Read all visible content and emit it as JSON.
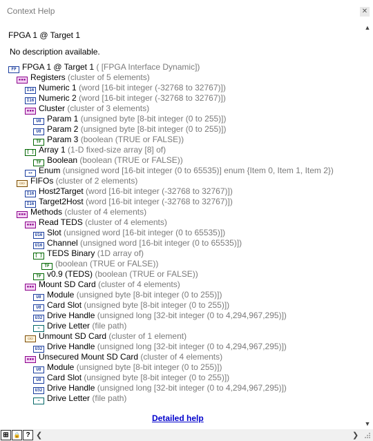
{
  "window": {
    "title": "Context Help"
  },
  "help": {
    "heading": "FPGA 1 @ Target 1",
    "description": "No description available.",
    "detailed_help_link": "Detailed help"
  },
  "icons": {
    "i16": "I16",
    "u8": "U8",
    "u16": "U16",
    "u32": "U32",
    "tf": "TF",
    "cluster": "▪▪▪",
    "array": "[ ]",
    "enum": "◂▸",
    "fifo": "▭▭",
    "fpga": "FP",
    "path": "⌁"
  },
  "tree": [
    {
      "depth": 0,
      "icon": "fpga",
      "name": "FPGA 1 @ Target 1",
      "type": "( [FPGA Interface Dynamic])"
    },
    {
      "depth": 1,
      "icon": "cluster",
      "name": "Registers",
      "type": "(cluster of 5 elements)"
    },
    {
      "depth": 2,
      "icon": "i16",
      "name": "Numeric 1",
      "type": "(word [16-bit integer (-32768 to 32767)])"
    },
    {
      "depth": 2,
      "icon": "i16",
      "name": "Numeric 2",
      "type": "(word [16-bit integer (-32768 to 32767)])"
    },
    {
      "depth": 2,
      "icon": "cluster",
      "name": "Cluster",
      "type": "(cluster of 3 elements)"
    },
    {
      "depth": 3,
      "icon": "u8",
      "name": "Param 1",
      "type": "(unsigned byte [8-bit integer (0 to 255)])"
    },
    {
      "depth": 3,
      "icon": "u8",
      "name": "Param 2",
      "type": "(unsigned byte [8-bit integer (0 to 255)])"
    },
    {
      "depth": 3,
      "icon": "tf",
      "name": "Param 3",
      "type": "(boolean (TRUE or FALSE))"
    },
    {
      "depth": 2,
      "icon": "array",
      "name": "Array 1",
      "type": "(1-D fixed-size array [8] of)"
    },
    {
      "depth": 3,
      "icon": "tf",
      "name": "Boolean",
      "type": "(boolean (TRUE or FALSE))"
    },
    {
      "depth": 2,
      "icon": "enum",
      "name": "Enum",
      "type": "(unsigned word [16-bit integer (0 to 65535)] enum {Item 0, Item 1, Item 2})"
    },
    {
      "depth": 1,
      "icon": "fifo",
      "name": "FIFOs",
      "type": "(cluster of 2 elements)"
    },
    {
      "depth": 2,
      "icon": "i16",
      "name": "Host2Target",
      "type": "(word [16-bit integer (-32768 to 32767)])"
    },
    {
      "depth": 2,
      "icon": "i16",
      "name": "Target2Host",
      "type": "(word [16-bit integer (-32768 to 32767)])"
    },
    {
      "depth": 1,
      "icon": "cluster",
      "name": "Methods",
      "type": "(cluster of 4 elements)"
    },
    {
      "depth": 2,
      "icon": "cluster",
      "name": "Read TEDS",
      "type": "(cluster of 4 elements)"
    },
    {
      "depth": 3,
      "icon": "u16",
      "name": "Slot",
      "type": "(unsigned word [16-bit integer (0 to 65535)])"
    },
    {
      "depth": 3,
      "icon": "u16",
      "name": "Channel",
      "type": "(unsigned word [16-bit integer (0 to 65535)])"
    },
    {
      "depth": 3,
      "icon": "array",
      "name": "TEDS Binary",
      "type": "(1D array of)"
    },
    {
      "depth": 4,
      "icon": "tf",
      "name": "",
      "type": "(boolean (TRUE or FALSE))"
    },
    {
      "depth": 3,
      "icon": "tf",
      "name": "v0.9 (TEDS)",
      "type": "(boolean (TRUE or FALSE))"
    },
    {
      "depth": 2,
      "icon": "cluster",
      "name": "Mount SD Card",
      "type": "(cluster of 4 elements)"
    },
    {
      "depth": 3,
      "icon": "u8",
      "name": "Module",
      "type": "(unsigned byte [8-bit integer (0 to 255)])"
    },
    {
      "depth": 3,
      "icon": "u8",
      "name": "Card Slot",
      "type": "(unsigned byte [8-bit integer (0 to 255)])"
    },
    {
      "depth": 3,
      "icon": "u32",
      "name": "Drive Handle",
      "type": "(unsigned long [32-bit integer (0 to 4,294,967,295)])"
    },
    {
      "depth": 3,
      "icon": "path",
      "name": "Drive Letter",
      "type": "(file path)"
    },
    {
      "depth": 2,
      "icon": "fifo",
      "name": "Unmount SD Card",
      "type": "(cluster of 1 element)"
    },
    {
      "depth": 3,
      "icon": "u32",
      "name": "Drive Handle",
      "type": "(unsigned long [32-bit integer (0 to 4,294,967,295)])"
    },
    {
      "depth": 2,
      "icon": "cluster",
      "name": "Unsecured Mount SD Card",
      "type": "(cluster of 4 elements)"
    },
    {
      "depth": 3,
      "icon": "u8",
      "name": "Module",
      "type": "(unsigned byte [8-bit integer (0 to 255)])"
    },
    {
      "depth": 3,
      "icon": "u8",
      "name": "Card Slot",
      "type": "(unsigned byte [8-bit integer (0 to 255)])"
    },
    {
      "depth": 3,
      "icon": "u32",
      "name": "Drive Handle",
      "type": "(unsigned long [32-bit integer (0 to 4,294,967,295)])"
    },
    {
      "depth": 3,
      "icon": "path",
      "name": "Drive Letter",
      "type": "(file path)"
    }
  ],
  "bottom_toolbar": {
    "show_optional_terminals_icon": "⊞",
    "lock_icon": "🔒",
    "help_icon": "?"
  }
}
